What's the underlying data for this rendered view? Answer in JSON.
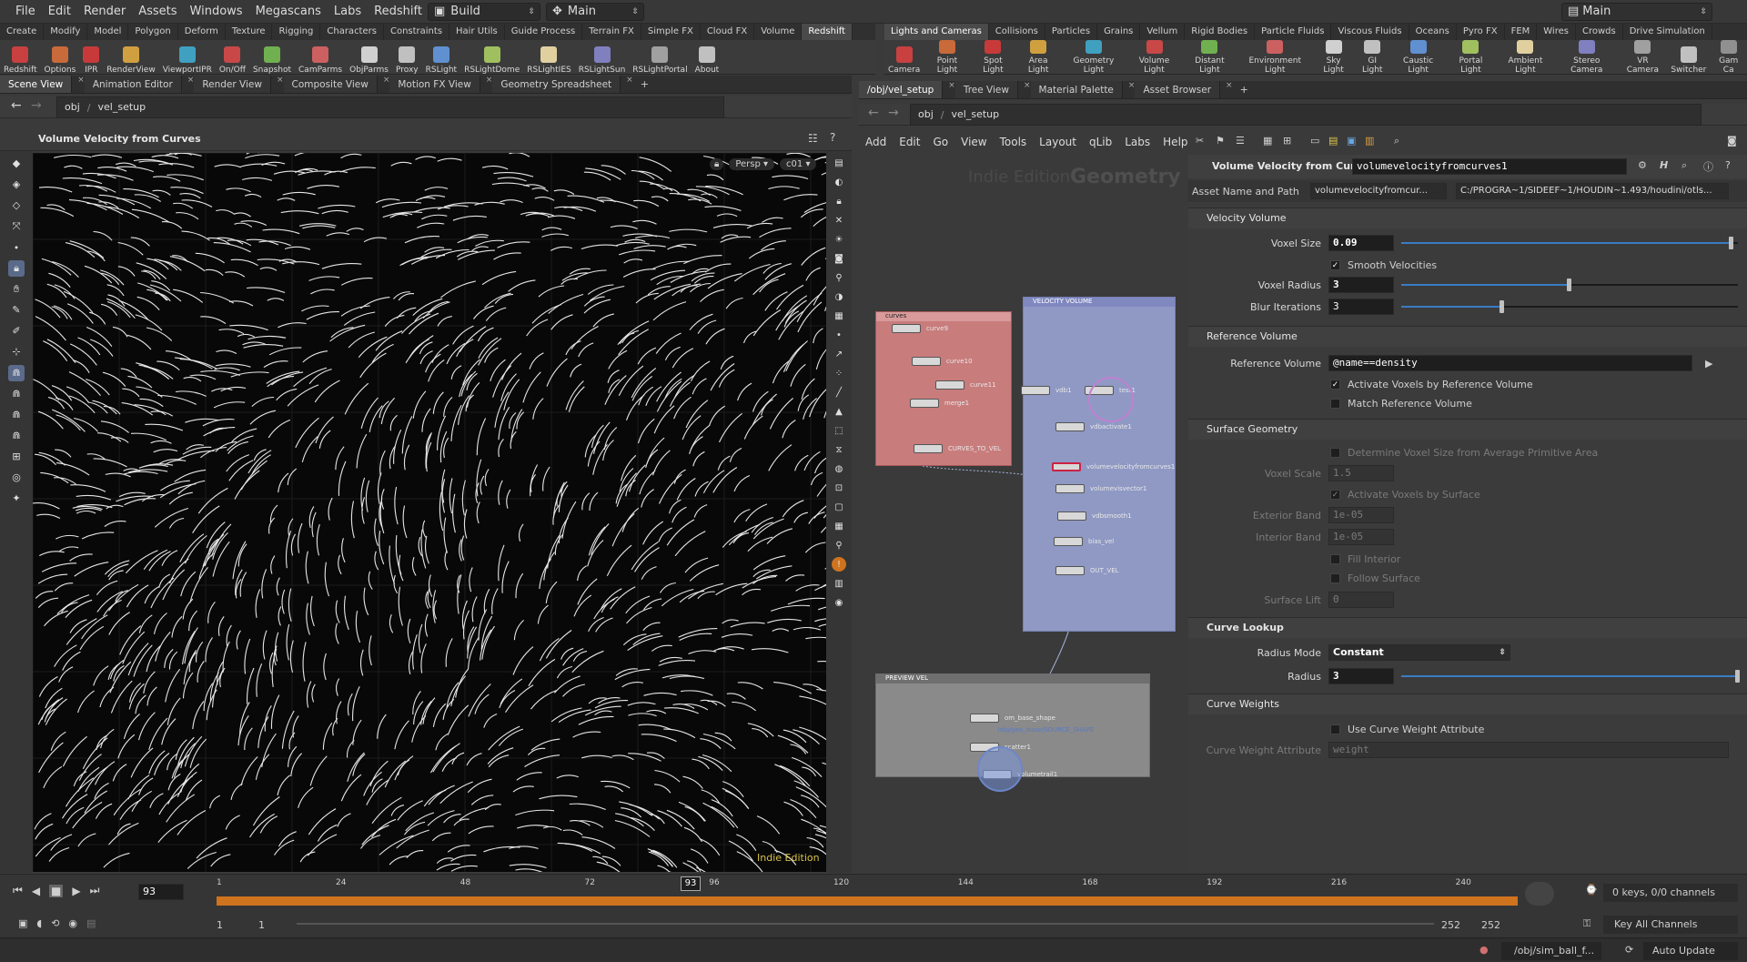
{
  "menubar": {
    "items": [
      "File",
      "Edit",
      "Render",
      "Assets",
      "Windows",
      "Megascans",
      "Labs",
      "Redshift",
      "qLib",
      "Help"
    ],
    "desktop": "Build",
    "layout": "Main",
    "right_dropdown": "Main"
  },
  "shelf_left": {
    "tabs": [
      "Create",
      "Modify",
      "Model",
      "Polygon",
      "Deform",
      "Texture",
      "Rigging",
      "Characters",
      "Constraints",
      "Hair Utils",
      "Guide Process",
      "Terrain FX",
      "Simple FX",
      "Cloud FX",
      "Volume",
      "Redshift"
    ],
    "active_tab": "Redshift",
    "tools": [
      "Redshift",
      "Options",
      "IPR",
      "RenderView",
      "ViewportIPR",
      "On/Off",
      "Snapshot",
      "CamParms",
      "ObjParms",
      "Proxy",
      "RSLight",
      "RSLightDome",
      "RSLightIES",
      "RSLightSun",
      "RSLightPortal",
      "About"
    ]
  },
  "shelf_right": {
    "tabs": [
      "Lights and Cameras",
      "Collisions",
      "Particles",
      "Grains",
      "Vellum",
      "Rigid Bodies",
      "Particle Fluids",
      "Viscous Fluids",
      "Oceans",
      "Pyro FX",
      "FEM",
      "Wires",
      "Crowds",
      "Drive Simulation"
    ],
    "active_tab": "Lights and Cameras",
    "tools": [
      "Camera",
      "Point Light",
      "Spot Light",
      "Area Light",
      "Geometry Light",
      "Volume Light",
      "Distant Light",
      "Environment Light",
      "Sky Light",
      "GI Light",
      "Caustic Light",
      "Portal Light",
      "Ambient Light",
      "Stereo Camera",
      "VR Camera",
      "Switcher",
      "Gam Ca"
    ]
  },
  "left_pane": {
    "tabs": [
      "Scene View",
      "Animation Editor",
      "Render View",
      "Composite View",
      "Motion FX View",
      "Geometry Spreadsheet"
    ],
    "active_tab": "Scene View",
    "path": [
      "obj",
      "vel_setup"
    ],
    "viewport_title": "Volume Velocity from Curves",
    "persp": "Persp",
    "cam": "c01",
    "watermark": "Indie Edition"
  },
  "right_pane": {
    "tabs": [
      "/obj/vel_setup",
      "Tree View",
      "Material Palette",
      "Asset Browser"
    ],
    "active_tab": "/obj/vel_setup",
    "path": [
      "obj",
      "vel_setup"
    ],
    "menu": [
      "Add",
      "Edit",
      "Go",
      "View",
      "Tools",
      "Layout",
      "qLib",
      "Labs",
      "Help"
    ],
    "edition_text": "Indie Edition",
    "context_text": "Geometry"
  },
  "network": {
    "boxes": [
      {
        "title": "curves"
      },
      {
        "title": "VELOCITY VOLUME"
      },
      {
        "title": "PREVIEW VEL"
      }
    ],
    "nodes": [
      "curve9",
      "curve10",
      "curve11",
      "merge1",
      "CURVES_TO_VEL",
      "vdb1",
      "test1",
      "vdbactivate1",
      "volumevelocityfromcurves1",
      "volumevisvector1",
      "vdbsmooth1",
      "bias_vel",
      "OUT_VEL",
      "om_base_shape",
      "/obj/geo_base/SOURCE_SHAPE",
      "scatter1",
      "volumetrail1"
    ]
  },
  "params": {
    "node_type": "Volume Velocity from Curves",
    "node_name": "volumevelocityfromcurves1",
    "asset_label": "Asset Name and Path",
    "asset_name": "volumevelocityfromcur...",
    "asset_path": "C:/PROGRA~1/SIDEEF~1/HOUDIN~1.493/houdini/otls...",
    "sections": {
      "velocity": "Velocity Volume",
      "reference": "Reference Volume",
      "surface": "Surface Geometry",
      "curve_lookup": "Curve Lookup",
      "curve_weights": "Curve Weights"
    },
    "voxel_size": {
      "label": "Voxel Size",
      "value": "0.09",
      "fraction": 0.98
    },
    "smooth_velocities": {
      "label": "Smooth Velocities",
      "checked": true
    },
    "voxel_radius": {
      "label": "Voxel Radius",
      "value": "3",
      "fraction": 0.5
    },
    "blur_iterations": {
      "label": "Blur Iterations",
      "value": "3",
      "fraction": 0.3
    },
    "reference_volume": {
      "label": "Reference Volume",
      "value": "@name==density"
    },
    "activate_by_ref": {
      "label": "Activate Voxels by Reference Volume",
      "checked": true
    },
    "match_ref": {
      "label": "Match Reference Volume",
      "checked": false
    },
    "determine_voxel": {
      "label": "Determine Voxel Size from Average Primitive Area"
    },
    "voxel_scale": {
      "label": "Voxel Scale",
      "value": "1.5"
    },
    "activate_by_surface": {
      "label": "Activate Voxels by Surface"
    },
    "exterior_band": {
      "label": "Exterior Band",
      "value": "1e-05"
    },
    "interior_band": {
      "label": "Interior Band",
      "value": "1e-05"
    },
    "fill_interior": {
      "label": "Fill Interior"
    },
    "follow_surface": {
      "label": "Follow Surface"
    },
    "surface_lift": {
      "label": "Surface Lift",
      "value": "0"
    },
    "radius_mode": {
      "label": "Radius Mode",
      "value": "Constant"
    },
    "radius": {
      "label": "Radius",
      "value": "3",
      "fraction": 1.0
    },
    "use_curve_weight": {
      "label": "Use Curve Weight Attribute"
    },
    "curve_weight_attr": {
      "label": "Curve Weight Attribute",
      "value": "weight"
    }
  },
  "timeline": {
    "frame": "93",
    "ticks": [
      "1",
      "24",
      "48",
      "72",
      "96",
      "120",
      "144",
      "168",
      "192",
      "216",
      "240"
    ],
    "current_marker": "93",
    "start": "1",
    "start2": "1",
    "end": "252",
    "end2": "252",
    "keys_info": "0 keys, 0/0 channels",
    "key_all": "Key All Channels"
  },
  "statusbar": {
    "path": "/obj/sim_ball_f...",
    "update": "Auto Update"
  },
  "colors": {
    "accent_orange": "#d0731e",
    "curves_box": "#c97c7c",
    "velocity_box": "#8f99c4",
    "preview_box": "#8a8a8a"
  }
}
